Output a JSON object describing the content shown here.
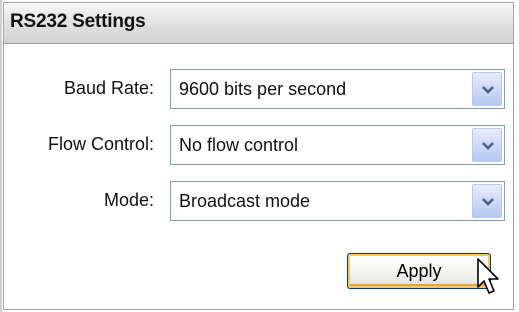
{
  "panel": {
    "title": "RS232 Settings"
  },
  "fields": [
    {
      "label": "Baud Rate:",
      "value": "9600 bits per second"
    },
    {
      "label": "Flow Control:",
      "value": "No flow control"
    },
    {
      "label": "Mode:",
      "value": "Broadcast mode"
    }
  ],
  "actions": {
    "apply_label": "Apply"
  },
  "colors": {
    "header_bg": "#dedede",
    "select_border": "#7f9db9",
    "dropdown_button": "#c7d6f6",
    "button_focus_ring": "#f4c860"
  },
  "icons": {
    "dropdown": "chevron-down-icon",
    "cursor": "mouse-pointer-icon"
  }
}
